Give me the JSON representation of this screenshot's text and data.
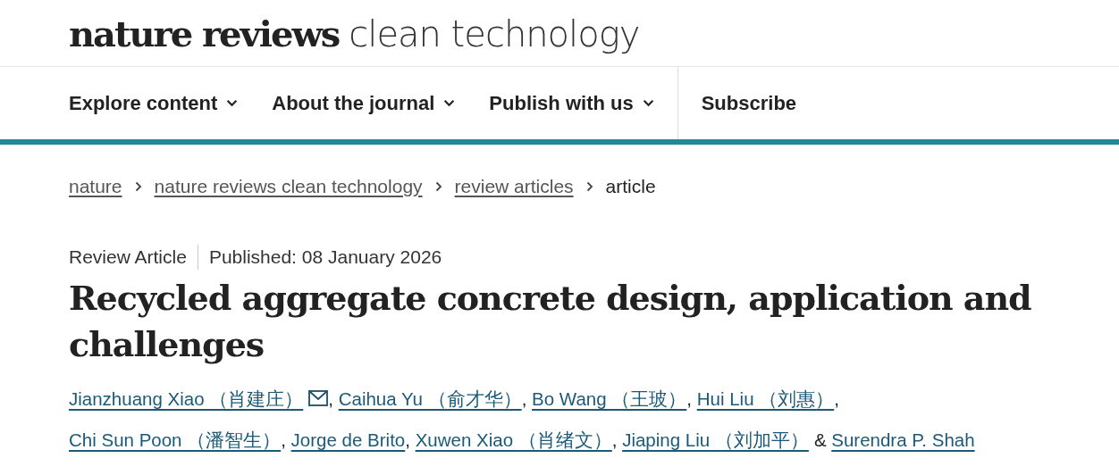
{
  "logo": {
    "brand": "nature reviews",
    "journal": "clean technology"
  },
  "nav": [
    {
      "label": "Explore content",
      "dropdown": true
    },
    {
      "label": "About the journal",
      "dropdown": true
    },
    {
      "label": "Publish with us",
      "dropdown": true
    },
    {
      "label": "Subscribe",
      "dropdown": false
    }
  ],
  "breadcrumbs": [
    {
      "label": "nature",
      "link": true
    },
    {
      "label": "nature reviews clean technology",
      "link": true
    },
    {
      "label": "review articles",
      "link": true
    },
    {
      "label": "article",
      "link": false
    }
  ],
  "article": {
    "type": "Review Article",
    "published": "Published: 08 January 2026",
    "title": "Recycled aggregate concrete design, application and challenges",
    "authors": [
      {
        "name": "Jianzhuang Xiao （肖建庄）",
        "email": true,
        "sep": ","
      },
      {
        "name": "Caihua Yu （俞才华）",
        "email": false,
        "sep": ","
      },
      {
        "name": "Bo Wang （王玻）",
        "email": false,
        "sep": ","
      },
      {
        "name": "Hui Liu （刘惠）",
        "email": false,
        "sep": ","
      },
      {
        "name": "Chi Sun Poon （潘智生）",
        "email": false,
        "sep": ","
      },
      {
        "name": "Jorge de Brito",
        "email": false,
        "sep": ","
      },
      {
        "name": "Xuwen Xiao （肖绪文）",
        "email": false,
        "sep": ","
      },
      {
        "name": "Jiaping Liu （刘加平）",
        "email": false,
        "sep": "&"
      },
      {
        "name": "Surendra P. Shah",
        "email": false
      }
    ]
  }
}
